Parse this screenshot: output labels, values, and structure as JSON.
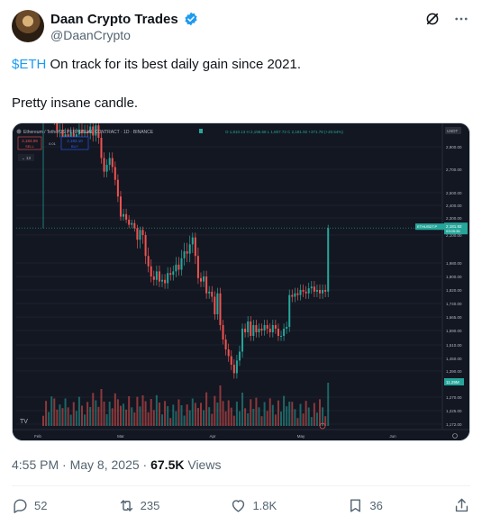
{
  "author": {
    "name": "Daan Crypto Trades",
    "handle": "@DaanCrypto",
    "verified": true
  },
  "post": {
    "cashtag": "$ETH",
    "line1_rest": " On track for its best daily gain since 2021.",
    "line2": "Pretty insane candle."
  },
  "chart": {
    "header": "Ethereum / TetherUS PERPETUAL CONTRACT · 1D · BINANCE",
    "ohlc": "O 1,810.13  H 2,196.68  L 1,807.72  C 2,181.92  +371.78 (+20.54%)",
    "sell_price": "2,183.09",
    "sell_label": "SELL",
    "buy_price": "2,183.10",
    "buy_label": "BUY",
    "spread": "0.01",
    "indicator_count": "13",
    "currency": "USDT",
    "symbol_tag": "ETHUSDT.P",
    "last_price": "2,181.92",
    "countdown": "03:05:36",
    "volume_tag": "11.29M",
    "y_ticks": [
      "2,900.00",
      "2,700.00",
      "2,500.00",
      "2,400.00",
      "2,300.00",
      "2,100.00",
      "1,980.00",
      "1,900.00",
      "1,820.00",
      "1,740.00",
      "1,665.00",
      "1,590.00",
      "1,510.00",
      "1,450.00",
      "1,390.00",
      "1,270.00",
      "1,225.00",
      "1,172.00"
    ],
    "x_ticks": [
      "Feb",
      "Mar",
      "Apr",
      "May",
      "Jun"
    ],
    "colors": {
      "bull": "#26a69a",
      "bear": "#ef5350",
      "bg": "#131722",
      "text": "#b2b5be"
    }
  },
  "chart_data": {
    "type": "candlestick",
    "title": "Ethereum / TetherUS PERPETUAL CONTRACT · 1D · BINANCE",
    "x_range": [
      "2025-01-23",
      "2025-06-10"
    ],
    "y_ticks": [
      2900,
      2700,
      2500,
      2400,
      2300,
      2100,
      1980,
      1900,
      1820,
      1740,
      1665,
      1590,
      1510,
      1450,
      1390,
      1270,
      1225,
      1172
    ],
    "last_close": 2181.92,
    "closes": [
      3270,
      3200,
      3230,
      3300,
      3150,
      3040,
      3050,
      2980,
      3010,
      2990,
      3020,
      2990,
      3010,
      3050,
      3020,
      3040,
      3020,
      3080,
      3000,
      3090,
      2980,
      2800,
      2680,
      2740,
      2800,
      2720,
      2610,
      2470,
      2310,
      2330,
      2280,
      2220,
      2240,
      2180,
      2080,
      2160,
      2100,
      2010,
      1960,
      1900,
      1880,
      1930,
      1870,
      1880,
      1860,
      1920,
      1910,
      1930,
      1970,
      1940,
      2000,
      2030,
      2020,
      2060,
      2090,
      2010,
      1890,
      1870,
      1900,
      1800,
      1810,
      1780,
      1680,
      1800,
      1620,
      1540,
      1490,
      1460,
      1420,
      1380,
      1440,
      1480,
      1600,
      1580,
      1640,
      1560,
      1620,
      1580,
      1600,
      1590,
      1620,
      1600,
      1580,
      1620,
      1600,
      1560,
      1560,
      1600,
      1610,
      1790,
      1780,
      1800,
      1790,
      1820,
      1810,
      1800,
      1830,
      1840,
      1810,
      1820,
      1800,
      1820,
      1810,
      2180
    ],
    "volume_tag": "11.29M"
  },
  "meta": {
    "time": "4:55 PM",
    "sep1": " · ",
    "date": "May 8, 2025",
    "sep2": " · ",
    "views": "67.5K",
    "views_label": " Views"
  },
  "actions": {
    "replies": "52",
    "reposts": "235",
    "likes": "1.8K",
    "bookmarks": "36"
  }
}
